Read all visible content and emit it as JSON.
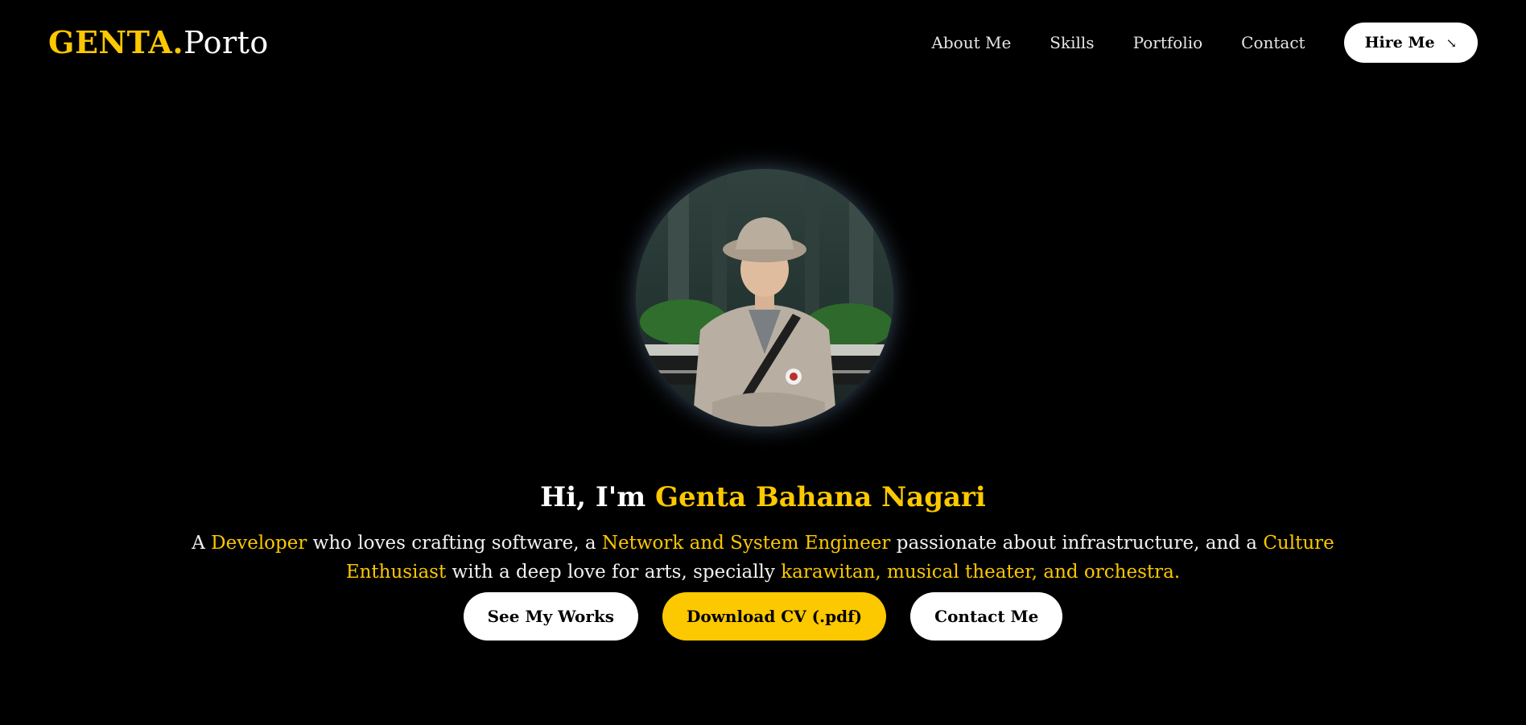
{
  "brand": {
    "logo_accent": "GENTA.",
    "logo_rest": "Porto"
  },
  "nav": {
    "items": [
      {
        "label": "About Me"
      },
      {
        "label": "Skills"
      },
      {
        "label": "Portfolio"
      },
      {
        "label": "Contact"
      }
    ],
    "hire_label": "Hire Me",
    "hire_icon": "↘"
  },
  "hero": {
    "greeting_prefix": "Hi, I'm ",
    "name": "Genta Bahana Nagari",
    "bio": {
      "p1": "A ",
      "h1": "Developer",
      "p2": " who loves crafting software, a ",
      "h2": "Network and System Engineer",
      "p3": " passionate about infrastructure, and a ",
      "h3": "Culture Enthusiast",
      "p4": " with a deep love for arts, specially ",
      "h4": "karawitan, musical theater, and orchestra."
    },
    "buttons": {
      "works": "See My Works",
      "cv": "Download CV (.pdf)",
      "contact": "Contact Me"
    }
  },
  "colors": {
    "accent": "#fcc800",
    "background": "#000000",
    "text": "#ffffff"
  },
  "icons": {
    "hire": "arrow-down-right-icon",
    "avatar": "profile-photo"
  }
}
